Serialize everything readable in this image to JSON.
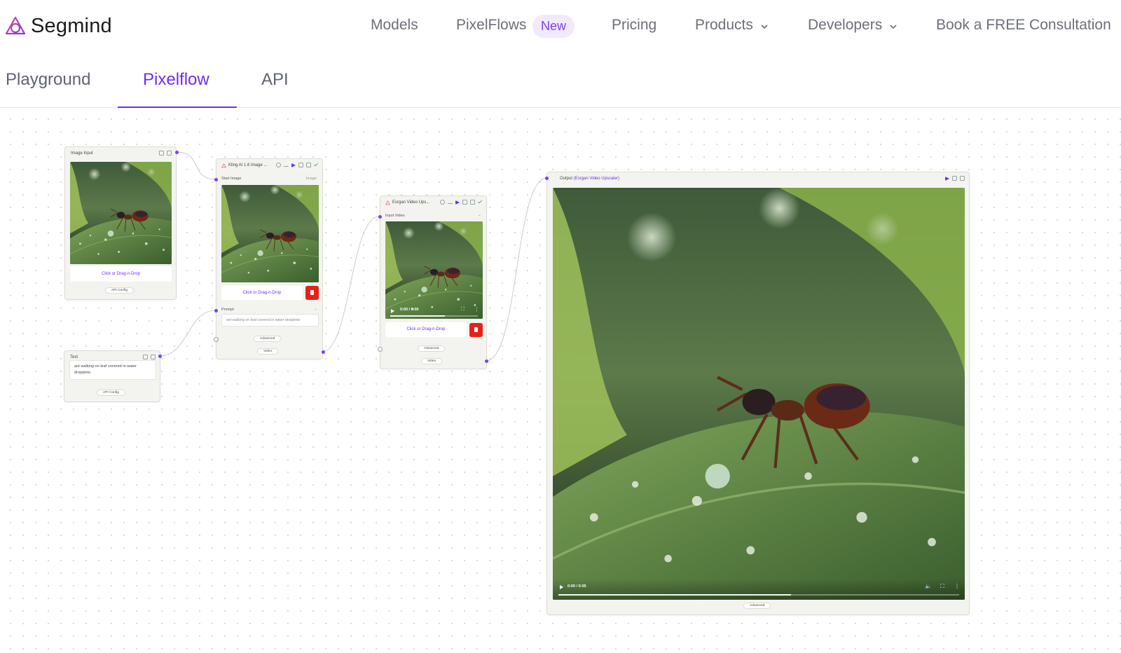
{
  "brand": {
    "name": "Segmind",
    "accent": "#6b2ef0"
  },
  "nav": {
    "models": "Models",
    "pixelflows": "PixelFlows",
    "new_badge": "New",
    "pricing": "Pricing",
    "products": "Products",
    "developers": "Developers",
    "consultation": "Book a FREE Consultation"
  },
  "tabs": {
    "playground": "Playground",
    "pixelflow": "Pixelflow",
    "api": "API",
    "active": "Pixelflow"
  },
  "nodes": {
    "image_input": {
      "title": "Image Input",
      "dropzone": "Click or Drag-n-Drop",
      "config": "API Config"
    },
    "text": {
      "title": "Text",
      "value": "ant walking on leaf covered in water dropplets",
      "config": "API Config"
    },
    "kling": {
      "title": "Kling AI 1.6 Image ...",
      "start_image_label": "Start Image",
      "start_image_type": "Image",
      "dropzone": "Click or Drag-n-Drop",
      "prompt_label": "Prompt",
      "prompt_value": "ant walking on leaf covered in water dropplets",
      "advanced": "Advanced",
      "output_type": "Video"
    },
    "esrgan": {
      "title": "Esrgan Video Ups...",
      "input_label": "Input Video",
      "video_time": "0:00 / 0:05",
      "progress": 0.62,
      "dropzone": "Click or Drag-n-Drop",
      "advanced": "Advanced",
      "output_type": "Video"
    },
    "output": {
      "title": "Output",
      "source": "(Esrgan Video Upscaler)",
      "video_time": "0:00 / 0:05",
      "progress": 0.58,
      "advanced": "Advanced"
    }
  }
}
